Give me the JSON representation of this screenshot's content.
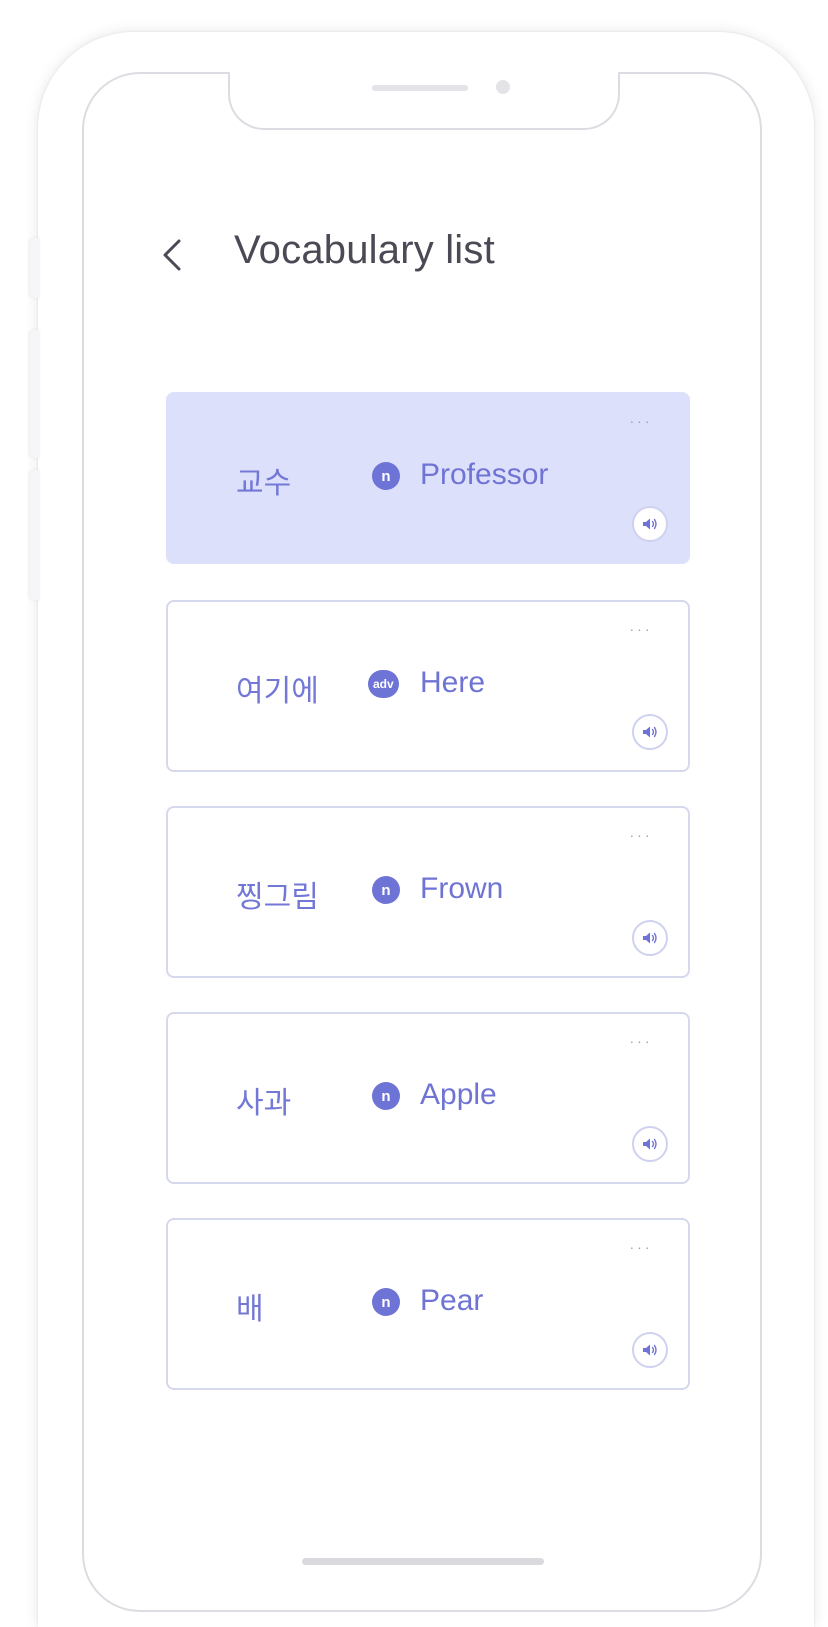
{
  "header": {
    "title": "Vocabulary list",
    "back_icon": "chevron-left-icon"
  },
  "colors": {
    "accent": "#6e73d6",
    "active_card": "#dde0fb",
    "card_border": "#d6d8ee",
    "title_text": "#4a4a55"
  },
  "vocabulary": [
    {
      "korean": "교수",
      "pos": "n",
      "english": "Professor",
      "more_label": "···",
      "active": true
    },
    {
      "korean": "여기에",
      "pos": "adv",
      "english": "Here",
      "more_label": "···",
      "active": false
    },
    {
      "korean": "찡그림",
      "pos": "n",
      "english": "Frown",
      "more_label": "···",
      "active": false
    },
    {
      "korean": "사과",
      "pos": "n",
      "english": "Apple",
      "more_label": "···",
      "active": false
    },
    {
      "korean": "배",
      "pos": "n",
      "english": "Pear",
      "more_label": "···",
      "active": false
    }
  ]
}
